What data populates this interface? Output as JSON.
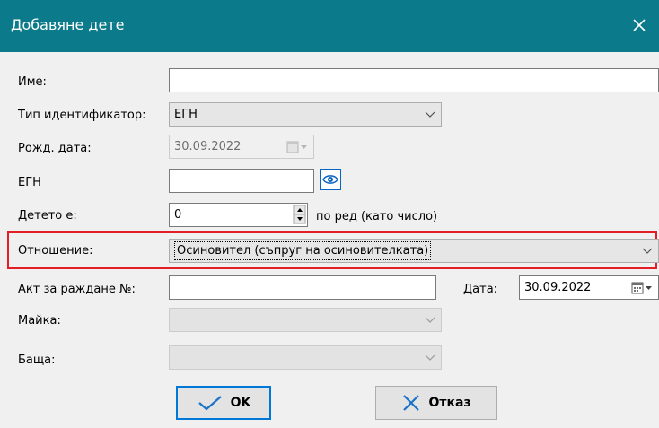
{
  "window": {
    "title": "Добавяне дете"
  },
  "form": {
    "name_label": "Име:",
    "name_value": "",
    "id_type_label": "Тип идентификатор:",
    "id_type_value": "ЕГН",
    "birth_date_label": "Рожд. дата:",
    "birth_date_value": "30.09.2022",
    "egn_label": "ЕГН",
    "egn_value": "",
    "child_order_label": "Детето е:",
    "child_order_value": "0",
    "child_order_suffix": "по ред (като число)",
    "relation_label": "Отношение:",
    "relation_value": "Осиновител (съпруг на осиновителката)",
    "birth_act_label": "Акт за раждане №:",
    "birth_act_value": "",
    "date_label": "Дата:",
    "date_value": "30.09.2022",
    "mother_label": "Майка:",
    "mother_value": "",
    "father_label": "Баща:",
    "father_value": ""
  },
  "buttons": {
    "ok_label": "OK",
    "cancel_label": "Отказ"
  },
  "colors": {
    "titlebar": "#0b7a8a",
    "highlight": "#e31e25",
    "accent": "#0078d7"
  },
  "icons": [
    "close-icon",
    "chevron-down-icon",
    "calendar-icon",
    "eye-icon",
    "spin-up-icon",
    "spin-down-icon",
    "checkmark-icon",
    "x-icon"
  ]
}
